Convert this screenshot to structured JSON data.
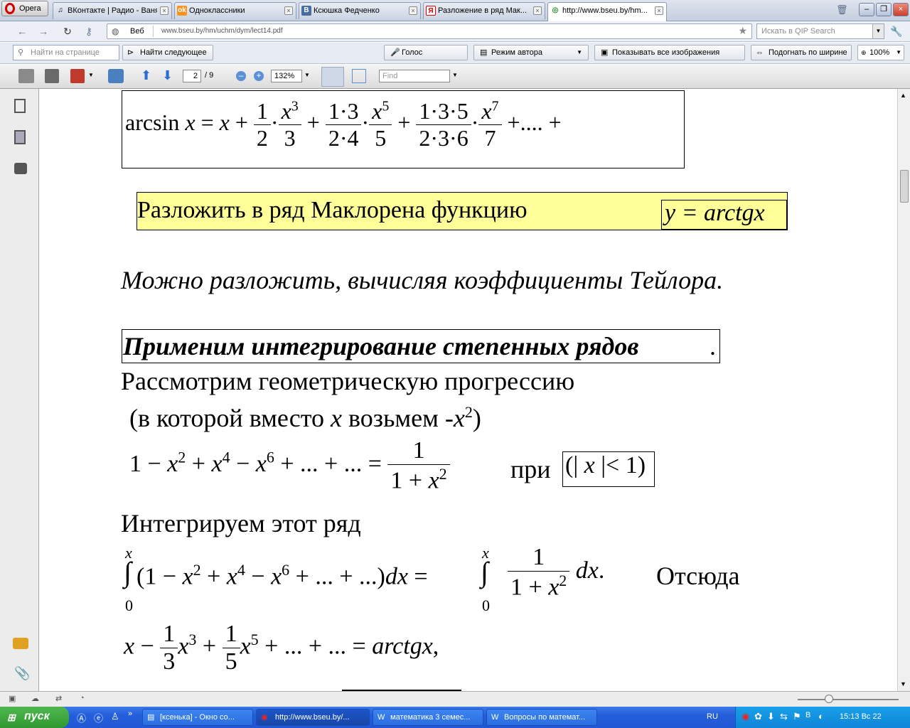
{
  "browser": {
    "opera_label": "Opera",
    "tabs": [
      {
        "label": "ВКонтакте | Радио - Ваня",
        "icon": "music-note-icon"
      },
      {
        "label": "Одноклассники",
        "icon": "odnoklassniki-icon"
      },
      {
        "label": "Ксюшка Федченко",
        "icon": "vk-icon"
      },
      {
        "label": "Разложение в ряд Мак...",
        "icon": "yandex-icon"
      },
      {
        "label": "http://www.bseu.by/hm...",
        "icon": "opera-icon"
      }
    ],
    "address": {
      "prefix": "Веб",
      "url": "www.bseu.by/hm/uchm/dym/lect14.pdf"
    },
    "search_placeholder": "Искать в QIP Search",
    "find": {
      "placeholder": "Найти на странице",
      "find_next": "Найти следующее",
      "voice": "Голос",
      "author_mode": "Режим автора",
      "show_images": "Показывать все изображения",
      "fit_width": "Подогнать по ширине",
      "zoom": "100%"
    }
  },
  "pdf_toolbar": {
    "page": "2",
    "page_total": "/ 9",
    "zoom": "132%",
    "find_placeholder": "Find"
  },
  "document": {
    "arcsin_label": "arcsin",
    "task_text": "Разложить в ряд Маклорена  функцию",
    "task_func": "y = arctgx",
    "italic_line": "Можно разложить, вычисляя коэффициенты Тейлора.",
    "bold_heading": "Применим  интегрирование степенных рядов",
    "heading_dot": ".",
    "line1": "Рассмотрим геометрическую прогрессию",
    "line2_a": "(в которой вместо",
    "line2_x": "x",
    "line2_b": "возьмем -",
    "pri": "при",
    "integrate_line": "Интегрируем этот ряд",
    "otsyuda": "Отсюда"
  },
  "taskbar": {
    "start": "пуск",
    "items": [
      "[ксенька] - Окно со...",
      "http://www.bseu.by/...",
      "математика 3 семес...",
      "Вопросы по математ..."
    ],
    "lang": "RU",
    "clock": "15:13 Вс 22"
  }
}
